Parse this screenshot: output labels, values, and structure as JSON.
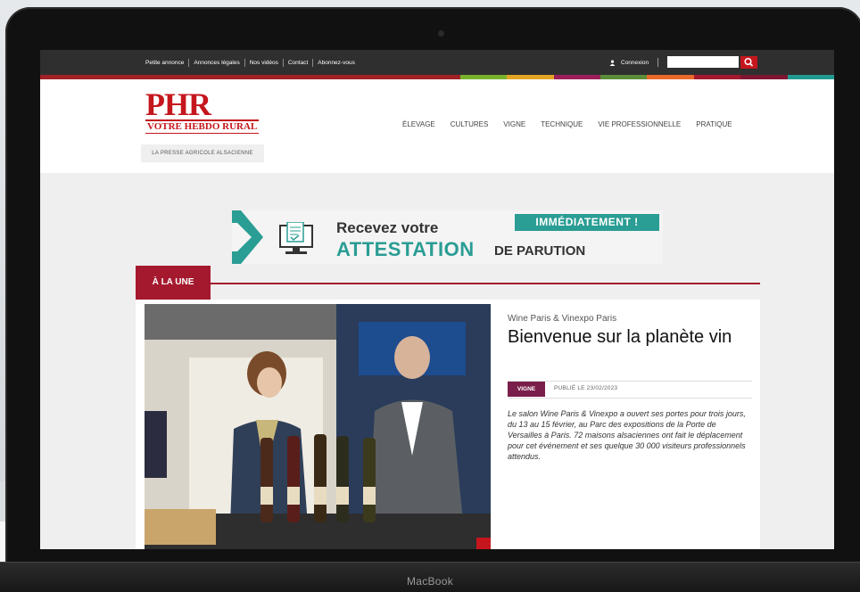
{
  "topbar": {
    "links": [
      "Petite annonce",
      "Annonces légales",
      "Nos vidéos",
      "Contact",
      "Abonnez-vous"
    ],
    "login_label": "Connexion",
    "search_placeholder": ""
  },
  "colors": {
    "brand_red": "#c5161d",
    "une_red": "#a5192e",
    "teal": "#2a9d94",
    "vigne_badge": "#7a1f4c",
    "strip": [
      "#a12127",
      "#a12127",
      "#a12127",
      "#a12127",
      "#a12127",
      "#a12127",
      "#a12127",
      "#a12127",
      "#a12127",
      "#78b22d",
      "#e2a524",
      "#9b1f5a",
      "#5b8d3a",
      "#e8692a",
      "#a5192e",
      "#7d1533",
      "#1f9b91"
    ]
  },
  "header": {
    "logo_main": "PHR",
    "logo_sub": "VOTRE HEBDO RURAL",
    "tagline": "LA PRESSE AGRICOLE ALSACIENNE",
    "nav": [
      "ÉLEVAGE",
      "CULTURES",
      "VIGNE",
      "TECHNIQUE",
      "VIE PROFESSIONNELLE",
      "PRATIQUE"
    ]
  },
  "ad": {
    "line1": "Recevez votre",
    "line2a": "ATTESTATION",
    "line2b": "DE PARUTION",
    "badge": "IMMÉDIATEMENT !"
  },
  "une": {
    "tab_label": "À LA UNE",
    "kicker": "Wine Paris & Vinexpo Paris",
    "headline": "Bienvenue sur la planète vin",
    "category": "VIGNE",
    "published": "PUBLIÉ LE 23/02/2023",
    "summary": "Le salon Wine Paris & Vinexpo a ouvert ses portes pour trois jours, du 13 au 15 février, au Parc des expositions de la Porte de Versailles à Paris. 72 maisons alsaciennes ont fait le déplacement pour cet événement et ses quelque 30 000 visiteurs professionnels attendus."
  },
  "device": {
    "label": "MacBook"
  }
}
